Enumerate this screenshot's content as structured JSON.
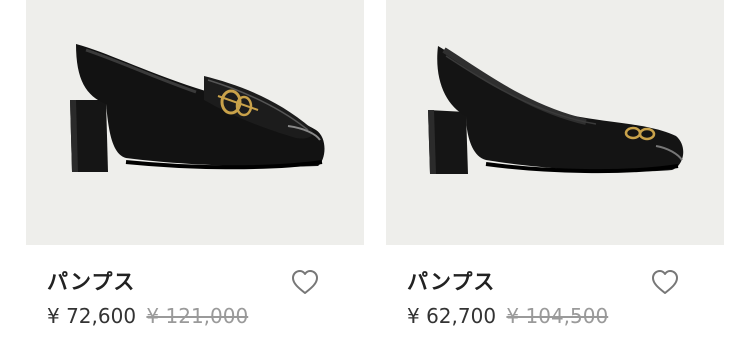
{
  "products": [
    {
      "name": "パンプス",
      "price": "¥ 72,600",
      "original_price": "¥ 121,000",
      "image": "black-loafer-pump-image",
      "favorite_icon": "heart-outline-icon"
    },
    {
      "name": "パンプス",
      "price": "¥ 62,700",
      "original_price": "¥ 104,500",
      "image": "black-pump-image",
      "favorite_icon": "heart-outline-icon"
    }
  ],
  "colors": {
    "image_background": "#eeeeeb",
    "price": "#333333",
    "original_price": "#9a9a9a"
  }
}
